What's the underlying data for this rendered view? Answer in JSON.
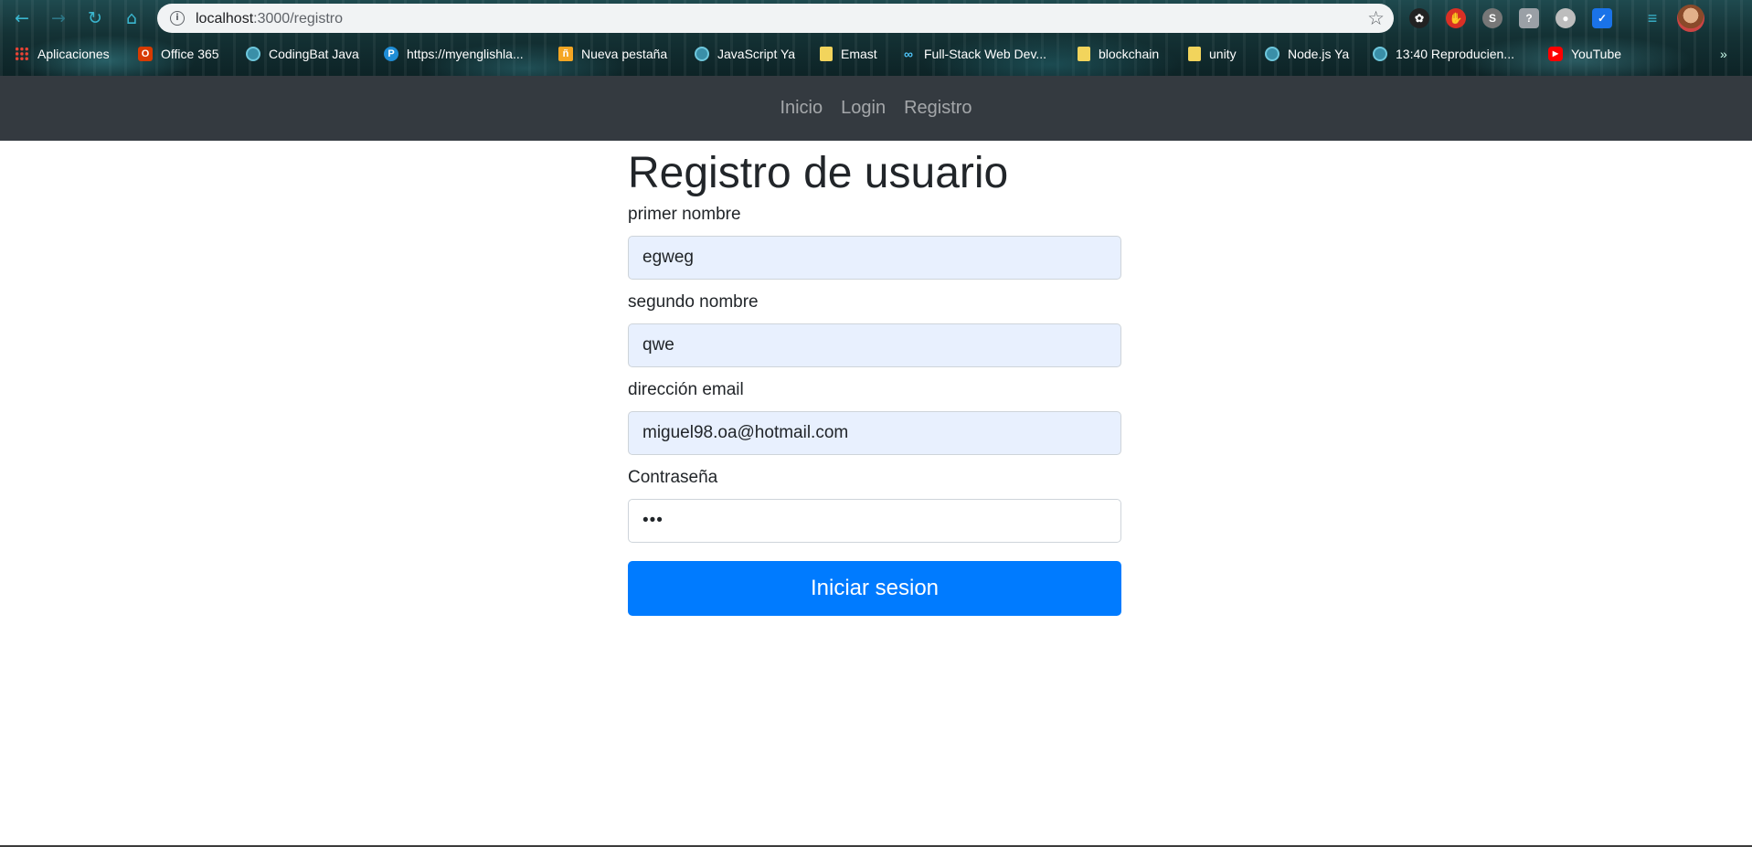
{
  "browser": {
    "url_host": "localhost",
    "url_path": ":3000/registro",
    "bookmarks": [
      {
        "label": "Aplicaciones",
        "icon": "apps-grid-icon"
      },
      {
        "label": "Office 365",
        "icon": "office-icon"
      },
      {
        "label": "CodingBat Java",
        "icon": "globe-icon"
      },
      {
        "label": "https://myenglishla...",
        "icon": "p-icon"
      },
      {
        "label": "Nueva pestaña",
        "icon": "pestana-icon"
      },
      {
        "label": "JavaScript Ya",
        "icon": "globe-icon"
      },
      {
        "label": "Emast",
        "icon": "folder-icon"
      },
      {
        "label": "Full-Stack Web Dev...",
        "icon": "infinity-icon"
      },
      {
        "label": "blockchain",
        "icon": "folder-icon"
      },
      {
        "label": "unity",
        "icon": "folder-icon"
      },
      {
        "label": "Node.js Ya",
        "icon": "globe-icon"
      },
      {
        "label": "13:40 Reproducien...",
        "icon": "globe-icon"
      },
      {
        "label": "YouTube",
        "icon": "youtube-icon"
      }
    ]
  },
  "navbar": {
    "links": [
      "Inicio",
      "Login",
      "Registro"
    ]
  },
  "form": {
    "title": "Registro de usuario",
    "first_name_label": "primer nombre",
    "first_name_value": "egweg",
    "last_name_label": "segundo nombre",
    "last_name_value": "qwe",
    "email_label": "dirección email",
    "email_value": "miguel98.oa@hotmail.com",
    "password_label": "Contraseña",
    "password_value": "•••",
    "submit_label": "Iniciar sesion"
  },
  "colors": {
    "navbar_bg": "#343a40",
    "primary": "#007bff",
    "autofill_bg": "#e8f0fe"
  }
}
